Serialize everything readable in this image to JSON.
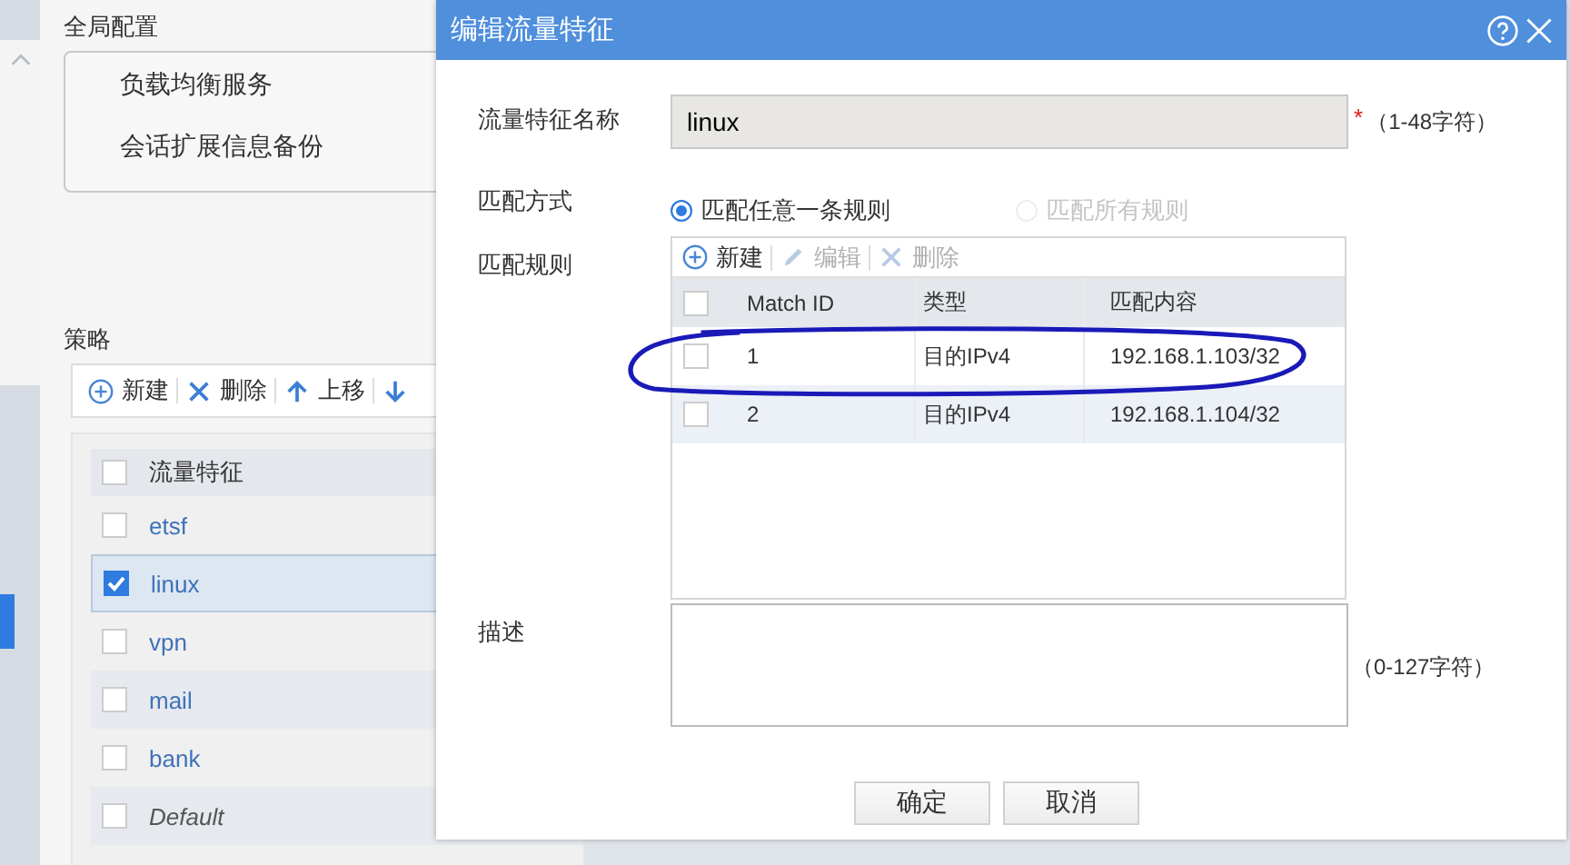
{
  "global_config": {
    "title": "全局配置",
    "items": [
      "负载均衡服务",
      "会话扩展信息备份"
    ]
  },
  "policy": {
    "title": "策略",
    "toolbar": [
      {
        "kind": "add",
        "label": "新建"
      },
      {
        "kind": "delete",
        "label": "删除"
      },
      {
        "kind": "up",
        "label": "上移"
      },
      {
        "kind": "down"
      }
    ],
    "columns": [
      "流量特征"
    ],
    "header_checked": false,
    "rows": [
      {
        "name": "etsf",
        "checked": false,
        "selected": false,
        "italic": false
      },
      {
        "name": "linux",
        "checked": true,
        "selected": true,
        "italic": false
      },
      {
        "name": "vpn",
        "checked": false,
        "selected": false,
        "italic": false
      },
      {
        "name": "mail",
        "checked": false,
        "selected": false,
        "italic": false
      },
      {
        "name": "bank",
        "checked": false,
        "selected": false,
        "italic": false
      },
      {
        "name": "Default",
        "checked": false,
        "selected": false,
        "italic": true
      }
    ]
  },
  "dialog": {
    "title": "编辑流量特征",
    "name_label": "流量特征名称",
    "name_value": "linux",
    "required_mark": "*",
    "name_hint": "（1-48字符）",
    "mode_label": "匹配方式",
    "modes": [
      {
        "label": "匹配任意一条规则",
        "selected": true,
        "disabled": false
      },
      {
        "label": "匹配所有规则",
        "selected": false,
        "disabled": true
      }
    ],
    "rules_label": "匹配规则",
    "rules_toolbar": [
      {
        "kind": "add",
        "label": "新建",
        "disabled": false
      },
      {
        "kind": "edit",
        "label": "编辑",
        "disabled": true
      },
      {
        "kind": "delete",
        "label": "删除",
        "disabled": true
      }
    ],
    "rules_columns": [
      "Match ID",
      "类型",
      "匹配内容"
    ],
    "rules_header_checked": false,
    "rules": [
      {
        "cells": [
          "1",
          "目的IPv4",
          "192.168.1.103/32"
        ],
        "checked": false
      },
      {
        "cells": [
          "2",
          "目的IPv4",
          "192.168.1.104/32"
        ],
        "checked": false
      }
    ],
    "desc_label": "描述",
    "desc_hint": "（0-127字符）",
    "buttons": [
      "确定",
      "取消"
    ]
  }
}
